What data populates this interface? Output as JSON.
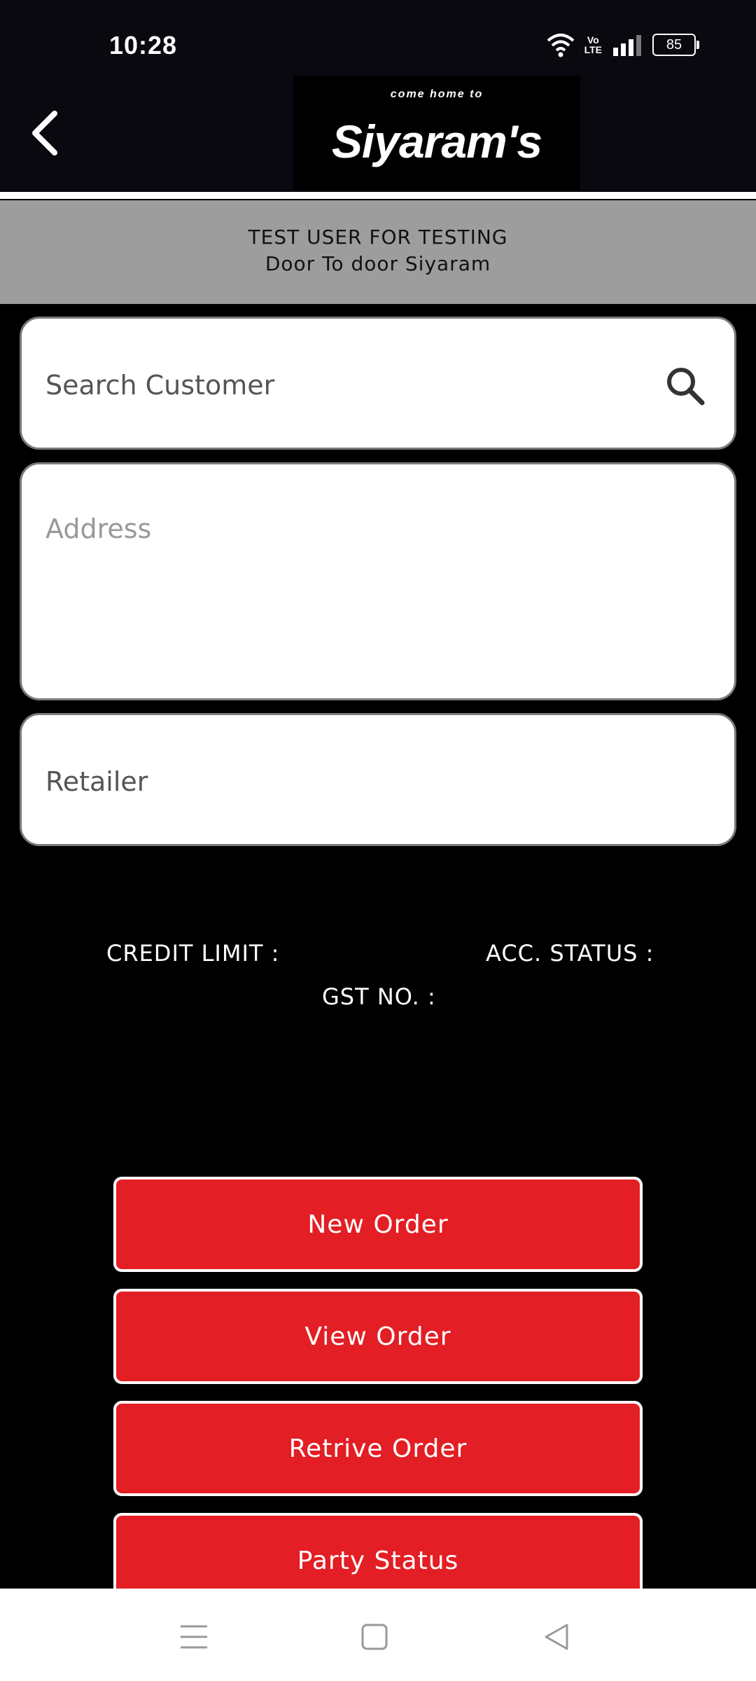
{
  "status": {
    "time": "10:28",
    "battery": "85",
    "volte_top": "Vo",
    "volte_bottom": "LTE",
    "icons": [
      "wifi-icon",
      "volte-icon",
      "signal-icon",
      "battery-icon"
    ]
  },
  "header": {
    "logo_tagline": "come home to",
    "logo_brand": "Siyaram's",
    "back_icon": "chevron-left-icon"
  },
  "user": {
    "line1": "TEST USER FOR TESTING",
    "line2": "Door To door Siyaram"
  },
  "form": {
    "search_placeholder": "Search Customer",
    "address_placeholder": "Address",
    "retailer_placeholder": "Retailer"
  },
  "info": {
    "credit_limit": "CREDIT LIMIT :",
    "acc_status": "ACC. STATUS :",
    "gst_no": "GST NO. :"
  },
  "actions": {
    "new_order": "New Order",
    "view_order": "View Order",
    "retrieve_order": "Retrive Order",
    "party_status": "Party Status"
  },
  "colors": {
    "accent_red": "#e31e24",
    "header_bg": "#0a0910",
    "user_bar_bg": "#9d9d9d"
  }
}
